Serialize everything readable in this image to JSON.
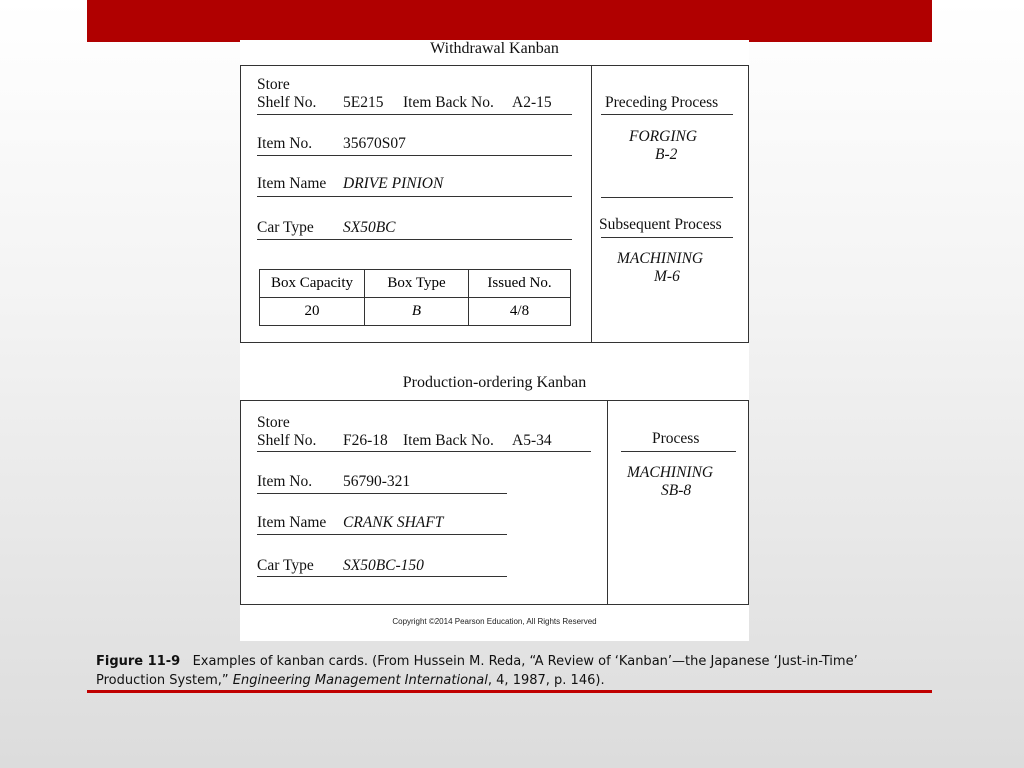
{
  "withdrawal": {
    "title": "Withdrawal Kanban",
    "store_label": "Store",
    "shelf_label": "Shelf No.",
    "shelf_value": "5E215",
    "item_back_label": "Item Back No.",
    "item_back_value": "A2-15",
    "item_no_label": "Item No.",
    "item_no_value": "35670S07",
    "item_name_label": "Item Name",
    "item_name_value": "DRIVE PINION",
    "car_type_label": "Car Type",
    "car_type_value": "SX50BC",
    "table_headers": [
      "Box Capacity",
      "Box Type",
      "Issued No."
    ],
    "table_values": [
      "20",
      "B",
      "4/8"
    ],
    "preceding_label": "Preceding Process",
    "preceding_line1": "FORGING",
    "preceding_line2": "B-2",
    "subsequent_label": "Subsequent Process",
    "subsequent_line1": "MACHINING",
    "subsequent_line2": "M-6"
  },
  "production": {
    "title": "Production-ordering Kanban",
    "store_label": "Store",
    "shelf_label": "Shelf No.",
    "shelf_value": "F26-18",
    "item_back_label": "Item Back No.",
    "item_back_value": "A5-34",
    "item_no_label": "Item No.",
    "item_no_value": "56790-321",
    "item_name_label": "Item Name",
    "item_name_value": "CRANK SHAFT",
    "car_type_label": "Car Type",
    "car_type_value": "SX50BC-150",
    "process_label": "Process",
    "process_line1": "MACHINING",
    "process_line2": "SB-8"
  },
  "copyright": "Copyright ©2014 Pearson Education, All Rights Reserved",
  "caption": {
    "figure_label": "Figure 11-9",
    "text_part1": "Examples of kanban cards. (From Hussein M. Reda, “A Review of ‘Kanban’—the Japanese ‘Just-in-Time’ Production System,” ",
    "journal": "Engineering Management International",
    "text_part2": ", 4, 1987, p. 146)."
  }
}
